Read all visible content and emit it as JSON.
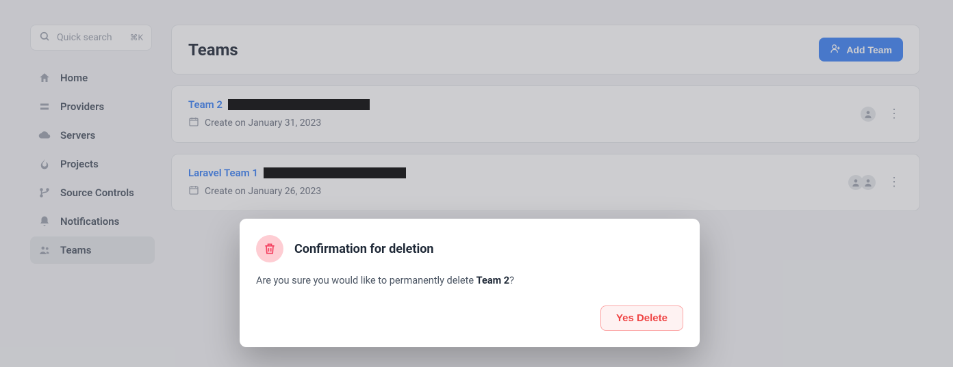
{
  "search": {
    "placeholder": "Quick search",
    "shortcut": "⌘K"
  },
  "sidebar": {
    "items": [
      {
        "label": "Home"
      },
      {
        "label": "Providers"
      },
      {
        "label": "Servers"
      },
      {
        "label": "Projects"
      },
      {
        "label": "Source Controls"
      },
      {
        "label": "Notifications"
      },
      {
        "label": "Teams"
      }
    ]
  },
  "header": {
    "title": "Teams",
    "add_button": "Add Team"
  },
  "teams": [
    {
      "name": "Team 2",
      "redacted_width": 207,
      "created_label": "Create on January 31, 2023",
      "avatar_count": 1
    },
    {
      "name": "Laravel Team 1",
      "redacted_width": 208,
      "created_label": "Create on January 26, 2023",
      "avatar_count": 2
    }
  ],
  "modal": {
    "title": "Confirmation for deletion",
    "body_prefix": "Are you sure you would like to permanently delete ",
    "body_subject": "Team 2",
    "body_suffix": "?",
    "confirm_button": "Yes Delete"
  }
}
